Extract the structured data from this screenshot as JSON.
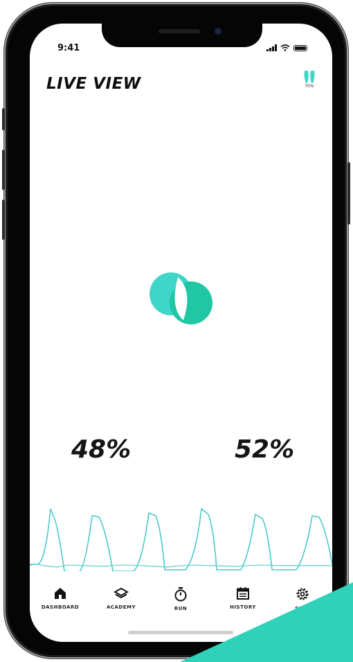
{
  "status_bar": {
    "time": "9:41"
  },
  "header": {
    "title": "LIVE VIEW",
    "insole_battery": "70%"
  },
  "pressure": {
    "left_percent": "48%",
    "right_percent": "52%"
  },
  "tabs": [
    {
      "label": "DASHBOARD",
      "icon": "home-icon"
    },
    {
      "label": "ACADEMY",
      "icon": "layers-icon"
    },
    {
      "label": "RUN",
      "icon": "stopwatch-icon"
    },
    {
      "label": "HISTORY",
      "icon": "calendar-icon"
    },
    {
      "label": "SETT",
      "icon": "gear-icon"
    }
  ],
  "colors": {
    "accent": "#3ed6c8",
    "accent_dark": "#1fc7a4",
    "wave": "#4cc9c9",
    "heat_high": "#e8452a",
    "heat_mid": "#f7d22b",
    "heat_low": "#35b34a"
  }
}
